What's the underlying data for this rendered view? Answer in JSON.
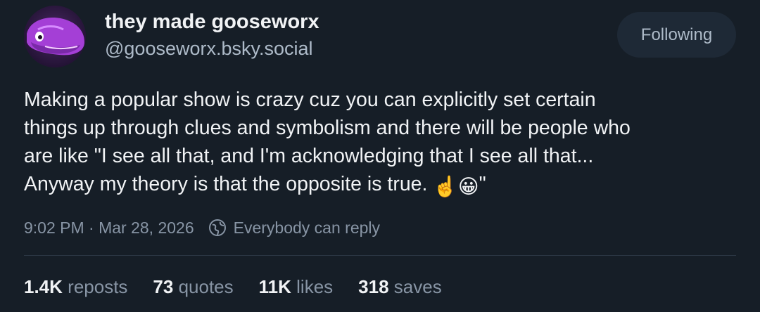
{
  "author": {
    "display_name": "they made gooseworx",
    "handle": "@gooseworx.bsky.social"
  },
  "follow_button": {
    "label": "Following"
  },
  "post": {
    "lines": [
      "Making a popular show is crazy cuz you can explicitly set certain",
      "things up through clues and symbolism and there will be people who",
      "are like \"I see all that, and I'm acknowledging that I see all that...",
      "Anyway my theory is that the opposite is true."
    ],
    "closing_quote": "\"",
    "emojis": [
      "☝️",
      "😀"
    ]
  },
  "meta": {
    "timestamp": "9:02 PM · Mar 28, 2026",
    "reply_setting": "Everybody can reply"
  },
  "stats": [
    {
      "count": "1.4K",
      "label": "reposts"
    },
    {
      "count": "73",
      "label": "quotes"
    },
    {
      "count": "11K",
      "label": "likes"
    },
    {
      "count": "318",
      "label": "saves"
    }
  ]
}
